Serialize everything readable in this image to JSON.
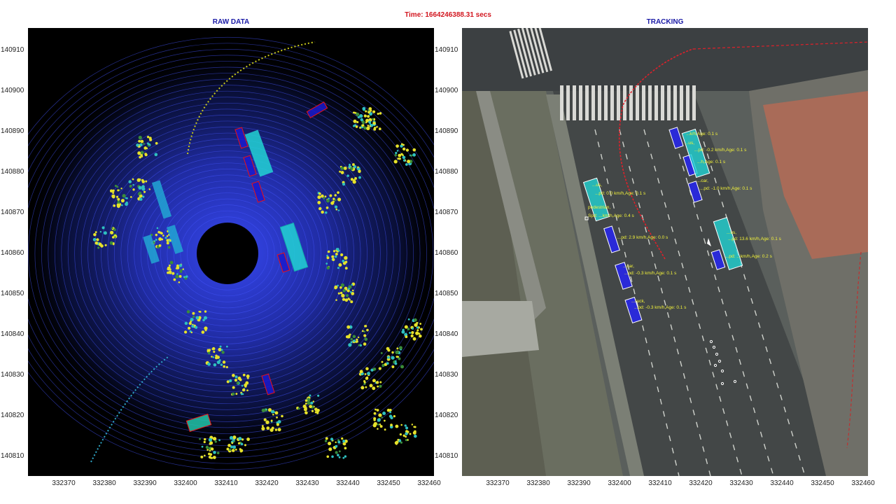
{
  "header": {
    "time_label": "Time: 1664246388.31 secs"
  },
  "panels": {
    "raw": {
      "title": "RAW DATA"
    },
    "tracking": {
      "title": "TRACKING"
    }
  },
  "axes": {
    "y_ticks": [
      "140910",
      "140900",
      "140890",
      "140880",
      "140870",
      "140860",
      "140850",
      "140840",
      "140830",
      "140820",
      "140810"
    ],
    "x_ticks": [
      "332370",
      "332380",
      "332390",
      "332400",
      "332410",
      "332420",
      "332430",
      "332440",
      "332450",
      "332460"
    ]
  },
  "tracks": [
    {
      "label": "...k/h,Age: 0.1 s"
    },
    {
      "label": "...us,"
    },
    {
      "label": "...pd: -0.2 km/h,Age: 0.1 s"
    },
    {
      "label": "...h,Age: 0.1 s"
    },
    {
      "label": "...car,"
    },
    {
      "label": "...pd: -1.0 km/h,Age: 0.1 s"
    },
    {
      "label": "...us,"
    },
    {
      "label": "...pd: 0.0 km/h,Age: 0.1 s"
    },
    {
      "label": "pedestrian,"
    },
    {
      "label": "Spd: ...km/h,Age: 0.4 s"
    },
    {
      "label": "...pd: 2.9 km/h,Age: 0.0 s"
    },
    {
      "label": "...us,"
    },
    {
      "label": "...pd: 13.6 km/h,Age: 0.1 s"
    },
    {
      "label": "...pd: ...km/h,Age: 0.2 s"
    },
    {
      "label": "...car,"
    },
    {
      "label": "...pd: -0.3 km/h,Age: 0.1 s"
    },
    {
      "label": "...ruck,"
    },
    {
      "label": "...pd: -0.3 km/h,Age: 0.1 s"
    }
  ],
  "colors": {
    "title_red": "#d2161f",
    "panel_title_blue": "#1a1aa6",
    "bus_cyan": "#22d3d3",
    "car_blue": "#2a2ad8",
    "label_yellow": "#f2f23a"
  }
}
